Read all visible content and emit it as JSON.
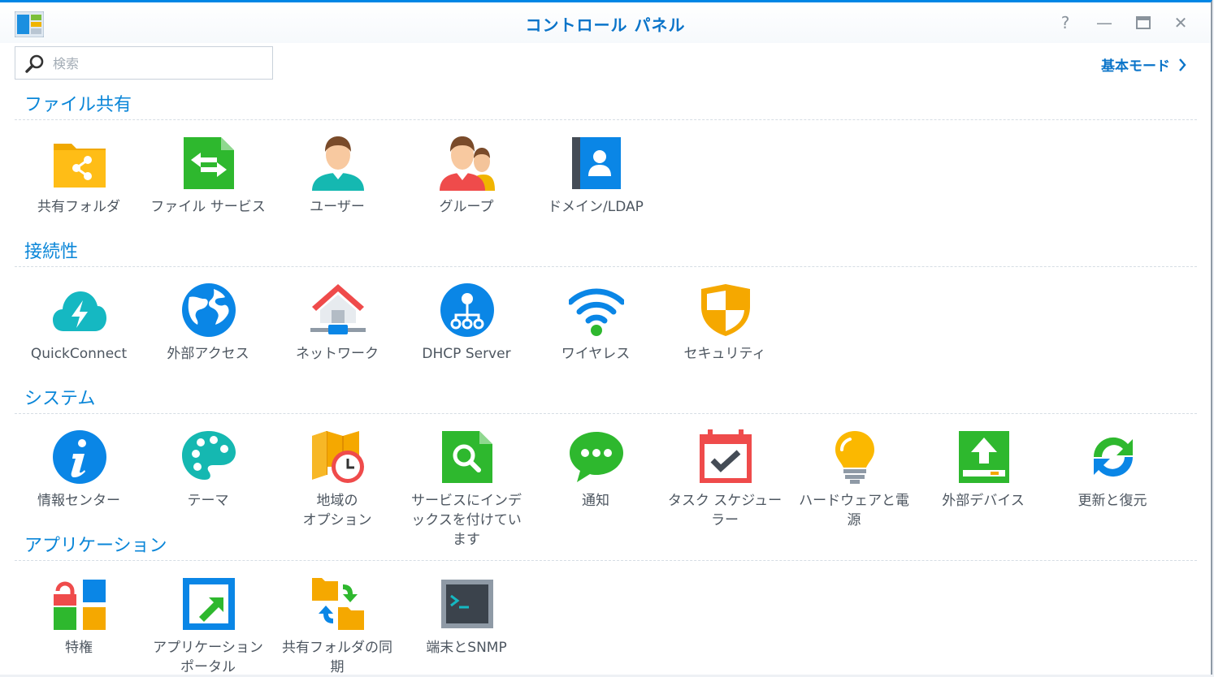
{
  "window": {
    "title": "コントロール パネル",
    "help": "?",
    "minimize": "—",
    "close": "✕"
  },
  "search": {
    "placeholder": "検索"
  },
  "mode_link": {
    "label": "基本モード",
    "arrow": "›"
  },
  "colors": {
    "accent": "#0a86d8",
    "title": "#0a74c9",
    "label": "#4d5660"
  },
  "sections": [
    {
      "title": "ファイル共有",
      "items": [
        {
          "label": "共有フォルダ",
          "icon": "shared-folder-icon"
        },
        {
          "label": "ファイル サービス",
          "icon": "file-services-icon"
        },
        {
          "label": "ユーザー",
          "icon": "user-icon"
        },
        {
          "label": "グループ",
          "icon": "group-icon"
        },
        {
          "label": "ドメイン/LDAP",
          "icon": "domain-ldap-icon"
        }
      ]
    },
    {
      "title": "接続性",
      "items": [
        {
          "label": "QuickConnect",
          "icon": "quickconnect-icon"
        },
        {
          "label": "外部アクセス",
          "icon": "globe-icon"
        },
        {
          "label": "ネットワーク",
          "icon": "network-house-icon"
        },
        {
          "label": "DHCP Server",
          "icon": "dhcp-server-icon"
        },
        {
          "label": "ワイヤレス",
          "icon": "wifi-icon"
        },
        {
          "label": "セキュリティ",
          "icon": "shield-icon"
        }
      ]
    },
    {
      "title": "システム",
      "items": [
        {
          "label": "情報センター",
          "icon": "info-icon"
        },
        {
          "label": "テーマ",
          "icon": "palette-icon"
        },
        {
          "label": "地域の\nオプション",
          "icon": "map-clock-icon"
        },
        {
          "label": "サービスにインデックスを付けています",
          "icon": "search-document-icon"
        },
        {
          "label": "通知",
          "icon": "chat-bubble-icon"
        },
        {
          "label": "タスク スケジューラー",
          "icon": "calendar-check-icon"
        },
        {
          "label": "ハードウェアと電源",
          "icon": "lightbulb-icon"
        },
        {
          "label": "外部デバイス",
          "icon": "external-drive-icon"
        },
        {
          "label": "更新と復元",
          "icon": "refresh-icon"
        }
      ]
    },
    {
      "title": "アプリケーション",
      "items": [
        {
          "label": "特権",
          "icon": "privileges-icon"
        },
        {
          "label": "アプリケーション ポータル",
          "icon": "app-portal-icon"
        },
        {
          "label": "共有フォルダの同期",
          "icon": "folder-sync-icon"
        },
        {
          "label": "端末とSNMP",
          "icon": "terminal-icon"
        }
      ]
    }
  ]
}
